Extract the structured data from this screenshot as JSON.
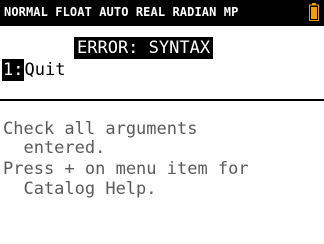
{
  "status_bar": {
    "mode_text": "NORMAL FLOAT AUTO REAL RADIAN MP",
    "battery_icon": "battery-icon",
    "battery_color": "#f0a000"
  },
  "error": {
    "title": "ERROR: SYNTAX"
  },
  "menu": {
    "items": [
      {
        "key": "1:",
        "label": "Quit"
      }
    ]
  },
  "help": {
    "lines": [
      "Check all arguments",
      "  entered.",
      "Press + on menu item for",
      "  Catalog Help."
    ]
  }
}
